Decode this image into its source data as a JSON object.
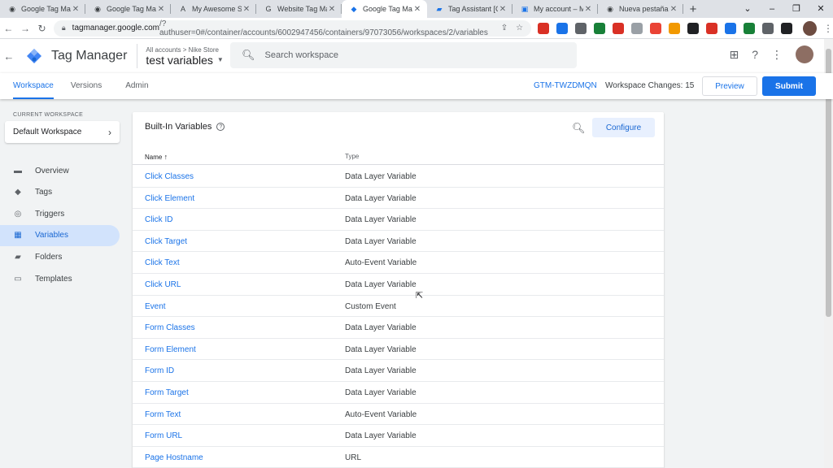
{
  "browser": {
    "tabs": [
      {
        "title": "Google Tag Mana",
        "icon": "globe-icon",
        "active": false
      },
      {
        "title": "Google Tag Mana",
        "icon": "globe-icon",
        "active": false
      },
      {
        "title": "My Awesome Sto",
        "icon": "a-logo-icon",
        "active": false
      },
      {
        "title": "Website Tag Man",
        "icon": "google-icon",
        "active": false
      },
      {
        "title": "Google Tag Mana",
        "icon": "gtm-icon",
        "active": true
      },
      {
        "title": "Tag Assistant [Co",
        "icon": "tag-assistant-icon",
        "active": false
      },
      {
        "title": "My account – My",
        "icon": "account-icon",
        "active": false
      },
      {
        "title": "Nueva pestaña",
        "icon": "chrome-icon",
        "active": false
      }
    ],
    "new_tab_glyph": "+",
    "url_host": "tagmanager.google.com",
    "url_path": "/?authuser=0#/container/accounts/6002947456/containers/97073056/workspaces/2/variables"
  },
  "header": {
    "product": "Tag Manager",
    "breadcrumb": "All accounts > Nike Store",
    "container_name": "test variables",
    "search_placeholder": "Search workspace"
  },
  "subnav": {
    "tabs": [
      "Workspace",
      "Versions",
      "Admin"
    ],
    "container_id": "GTM-TWZDMQN",
    "changes_label": "Workspace Changes: 15",
    "preview_label": "Preview",
    "submit_label": "Submit"
  },
  "sidebar": {
    "current_workspace_label": "CURRENT WORKSPACE",
    "workspace_name": "Default Workspace",
    "items": [
      {
        "label": "Overview",
        "icon": "overview-icon"
      },
      {
        "label": "Tags",
        "icon": "tag-icon"
      },
      {
        "label": "Triggers",
        "icon": "trigger-icon"
      },
      {
        "label": "Variables",
        "icon": "variables-icon",
        "active": true
      },
      {
        "label": "Folders",
        "icon": "folder-icon"
      },
      {
        "label": "Templates",
        "icon": "template-icon"
      }
    ]
  },
  "card": {
    "title": "Built-In Variables",
    "configure_label": "Configure",
    "col_name": "Name",
    "col_type": "Type",
    "sort_glyph": "↑",
    "rows": [
      {
        "name": "Click Classes",
        "type": "Data Layer Variable"
      },
      {
        "name": "Click Element",
        "type": "Data Layer Variable"
      },
      {
        "name": "Click ID",
        "type": "Data Layer Variable"
      },
      {
        "name": "Click Target",
        "type": "Data Layer Variable"
      },
      {
        "name": "Click Text",
        "type": "Auto-Event Variable"
      },
      {
        "name": "Click URL",
        "type": "Data Layer Variable"
      },
      {
        "name": "Event",
        "type": "Custom Event"
      },
      {
        "name": "Form Classes",
        "type": "Data Layer Variable"
      },
      {
        "name": "Form Element",
        "type": "Data Layer Variable"
      },
      {
        "name": "Form ID",
        "type": "Data Layer Variable"
      },
      {
        "name": "Form Target",
        "type": "Data Layer Variable"
      },
      {
        "name": "Form Text",
        "type": "Auto-Event Variable"
      },
      {
        "name": "Form URL",
        "type": "Data Layer Variable"
      },
      {
        "name": "Page Hostname",
        "type": "URL"
      }
    ]
  },
  "colors": {
    "accent": "#1a73e8",
    "gtm_blue": "#4285f4",
    "gtm_dark": "#1967d2",
    "active_nav_bg": "#d2e3fc",
    "ext_colors": [
      "#d93025",
      "#1a73e8",
      "#5f6368",
      "#188038",
      "#d93025",
      "#9aa0a6",
      "#ea4335",
      "#f29900",
      "#202124",
      "#d93025",
      "#1a73e8",
      "#188038",
      "#5f6368",
      "#202124"
    ]
  }
}
